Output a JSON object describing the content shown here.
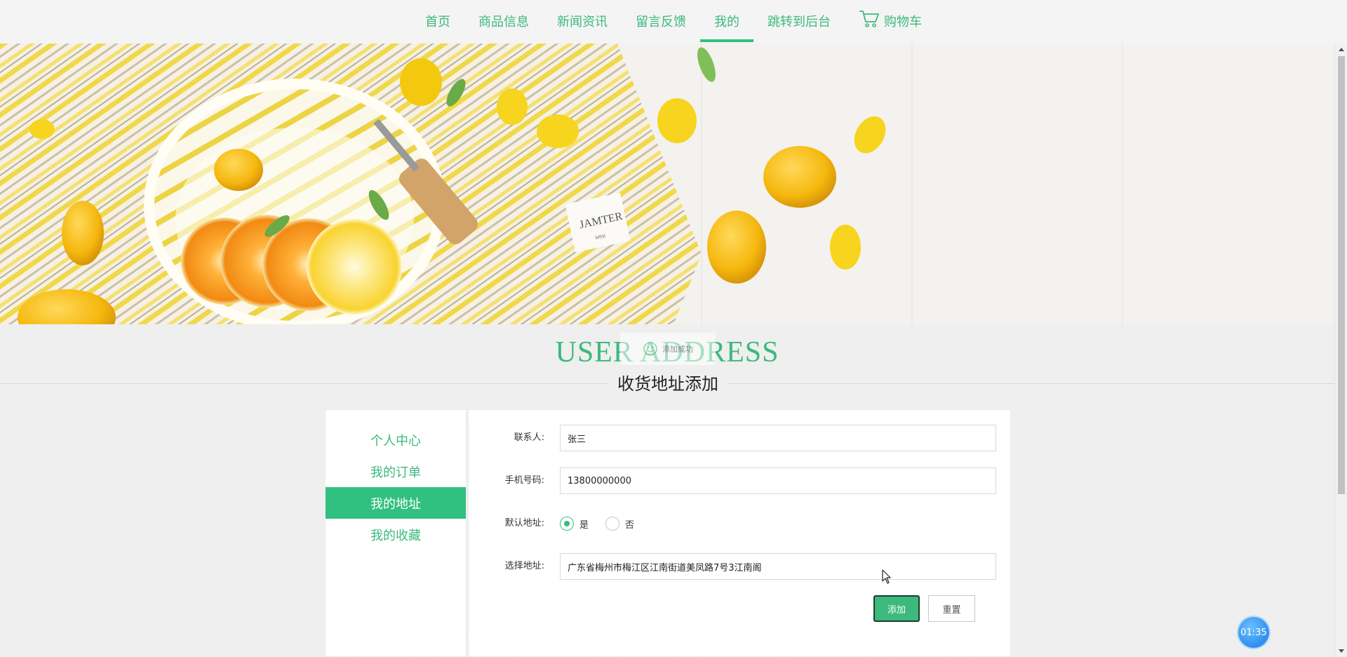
{
  "nav": {
    "items": [
      {
        "label": "首页",
        "active": false
      },
      {
        "label": "商品信息",
        "active": false
      },
      {
        "label": "新闻资讯",
        "active": false
      },
      {
        "label": "留言反馈",
        "active": false
      },
      {
        "label": "我的",
        "active": true
      },
      {
        "label": "跳转到后台",
        "active": false
      }
    ],
    "cart_label": "购物车",
    "cart_icon": "cart-icon"
  },
  "banner": {
    "tag_line1": "JAMTER",
    "tag_line2": "MINI"
  },
  "section": {
    "title_en": "USER ADDRESS",
    "title_cn": "收货地址添加"
  },
  "toast": {
    "icon": "smile-icon",
    "text": "添加成功"
  },
  "sidebar": {
    "items": [
      {
        "label": "个人中心",
        "active": false
      },
      {
        "label": "我的订单",
        "active": false
      },
      {
        "label": "我的地址",
        "active": true
      },
      {
        "label": "我的收藏",
        "active": false
      }
    ]
  },
  "form": {
    "contact_label": "联系人:",
    "contact_value": "张三",
    "phone_label": "手机号码:",
    "phone_value": "13800000000",
    "default_label": "默认地址:",
    "default_options": [
      "是",
      "否"
    ],
    "default_selected": "是",
    "address_label": "选择地址:",
    "address_value": "广东省梅州市梅江区江南街道美凤路7号3江南阁",
    "add_button": "添加",
    "reset_button": "重置"
  },
  "timer": {
    "value": "01:35"
  },
  "colors": {
    "accent": "#32c080",
    "nav_text": "#3cb97d"
  }
}
